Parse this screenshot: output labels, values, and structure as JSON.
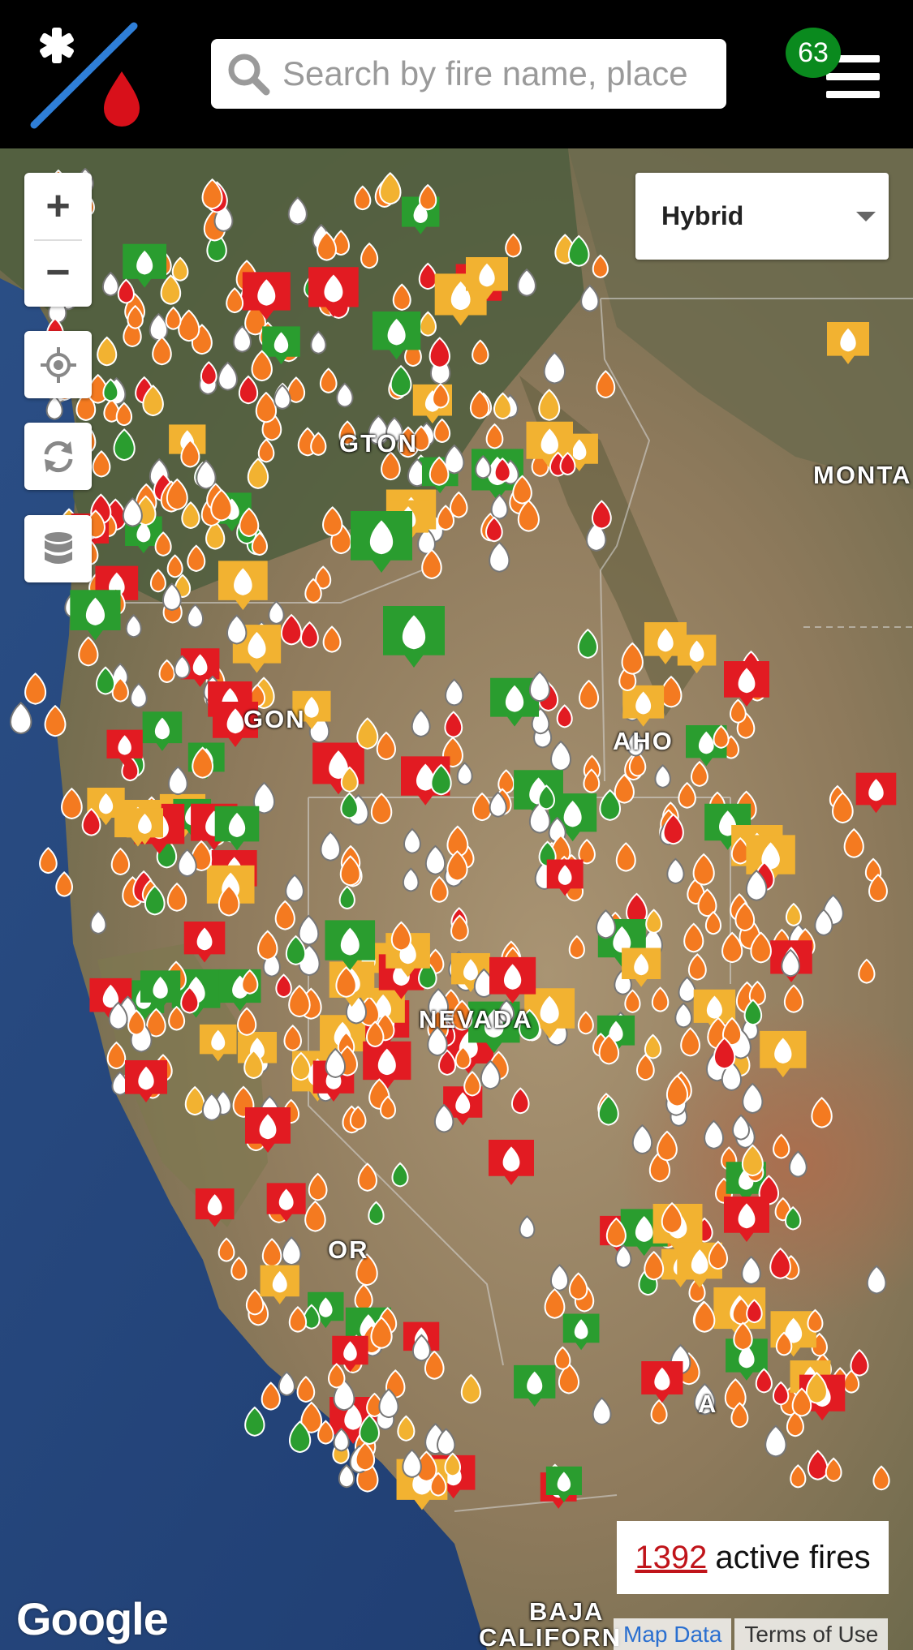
{
  "header": {
    "logo_icon": "inciweb-asterisk-drop-logo",
    "search_placeholder": "Search by fire name, place",
    "notification_count": "63",
    "menu_icon": "hamburger-menu-icon"
  },
  "map_controls": {
    "zoom_in": "+",
    "zoom_out": "−",
    "locate_icon": "crosshair-icon",
    "refresh_icon": "refresh-icon",
    "layers_icon": "database-icon",
    "map_type": "Hybrid"
  },
  "map_labels": {
    "washington": "GTON",
    "oregon": "GON",
    "idaho": "AHO",
    "montana": "MONTA",
    "nevada": "NEVADA",
    "california": "OR",
    "baja": "BAJA",
    "baja2": "CALIFORN",
    "arizona": "A"
  },
  "status": {
    "count": "1392",
    "count_suffix": "active fires"
  },
  "footer": {
    "google": "Google",
    "map_data": "Map Data",
    "terms": "Terms of Use"
  },
  "colors": {
    "active_red": "#e21b22",
    "new_orange": "#f47a20",
    "complex_yellow": "#f2b231",
    "contained_green": "#2a9d2f",
    "out_white": "#ffffff",
    "badge_green": "#0a8a1e"
  }
}
